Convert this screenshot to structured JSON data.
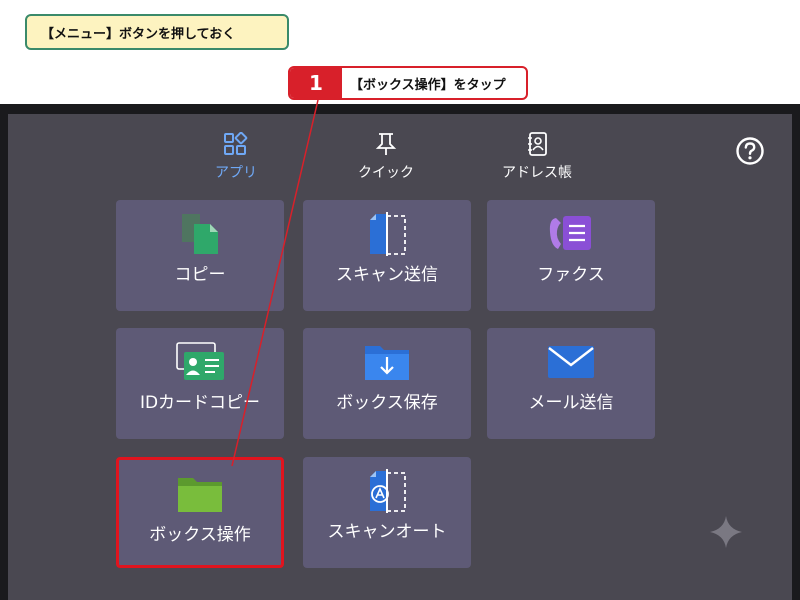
{
  "step_tag": "【メニュー】ボタンを押しておく",
  "callout": {
    "number": "1",
    "text": "【ボックス操作】をタップ"
  },
  "nav": {
    "tabs": [
      {
        "label": "アプリ",
        "icon": "apps-grid-icon",
        "active": true
      },
      {
        "label": "クイック",
        "icon": "pin-icon",
        "active": false
      },
      {
        "label": "アドレス帳",
        "icon": "address-book-icon",
        "active": false
      }
    ],
    "help_icon": "help-icon"
  },
  "apps": [
    {
      "label": "コピー",
      "icon": "copy-icon"
    },
    {
      "label": "スキャン送信",
      "icon": "scan-send-icon"
    },
    {
      "label": "ファクス",
      "icon": "fax-icon"
    },
    {
      "label": "IDカードコピー",
      "icon": "id-card-icon"
    },
    {
      "label": "ボックス保存",
      "icon": "box-save-icon"
    },
    {
      "label": "メール送信",
      "icon": "mail-icon"
    },
    {
      "label": "ボックス操作",
      "icon": "box-folder-icon",
      "selected": true
    },
    {
      "label": "スキャンオート",
      "icon": "scan-auto-icon"
    }
  ],
  "colors": {
    "highlight": "#e0141e",
    "accent_blue": "#6fa8f5",
    "tile": "#5e5a76",
    "panel": "#4a4851"
  }
}
